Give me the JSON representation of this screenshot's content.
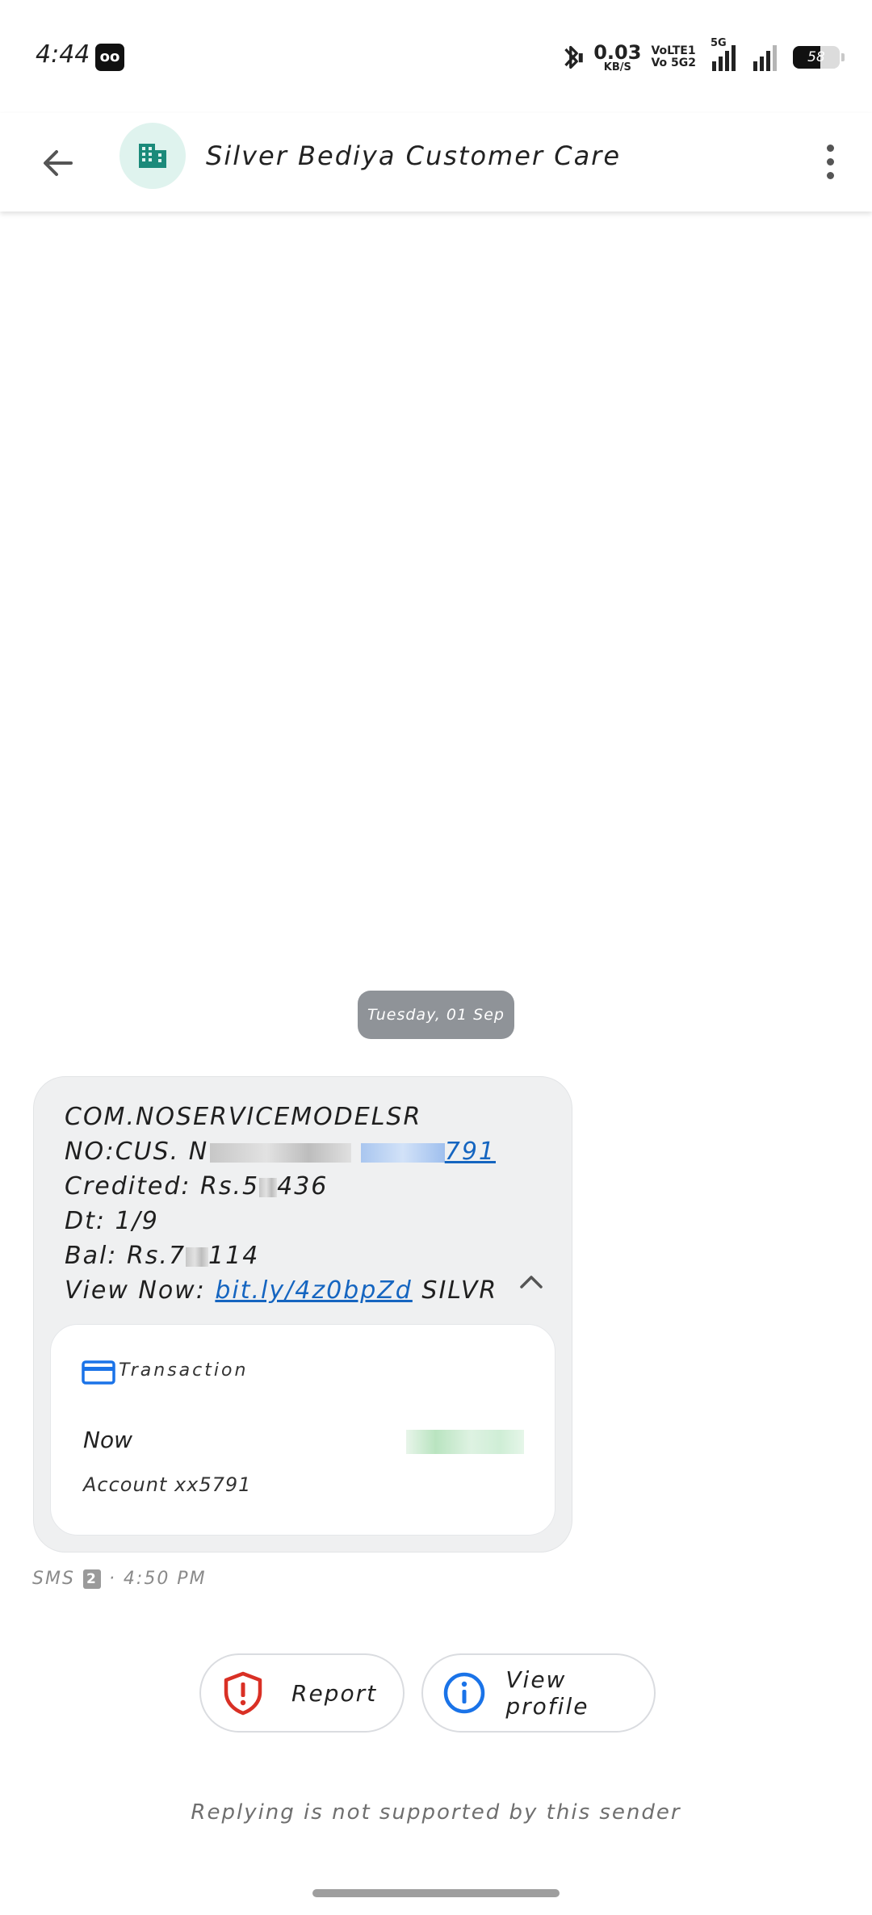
{
  "status_bar": {
    "time": "4:44",
    "app_icon": "oo",
    "net_speed_value": "0.03",
    "net_speed_unit": "KB/S",
    "volte_line1": "VoLTE1",
    "volte_line2": "Vo 5G2",
    "sim1_network": "5G",
    "battery_level": "58",
    "battery_fraction": 0.58,
    "icons": [
      "bluetooth-icon",
      "signal-icon",
      "battery-icon"
    ]
  },
  "app_bar": {
    "contact_name": "Silver Bediya Customer Care",
    "icons": [
      "back-arrow-icon",
      "business-icon",
      "more-vert-icon"
    ]
  },
  "date_chip": "Tuesday, 01 Sep",
  "message": {
    "line1": "COM.NOSERVICEMODELSR",
    "line2_prefix": "NO:CUS. N",
    "line2_link_tail": "791",
    "line3_prefix": "Credited: Rs.5",
    "line3_suffix": "436",
    "line4": "Dt: 1/9",
    "line5_prefix": "Bal: Rs.7",
    "line5_suffix": "114",
    "line6_prefix": "View Now: ",
    "line6_link": "bit.ly/4z0bpZd",
    "line6_suffix": " SILVR"
  },
  "transaction_card": {
    "title": "Transaction",
    "when": "Now",
    "account": "Account xx5791",
    "icon": "credit-card-icon"
  },
  "meta": {
    "type": "SMS",
    "sim": "2",
    "time": "· 4:50 PM"
  },
  "actions": {
    "report_label": "Report",
    "view_profile_label": "View profile"
  },
  "footer_note": "Replying is not supported by this sender",
  "colors": {
    "accent_blue": "#1a73e8",
    "report_red": "#d93025",
    "bubble_bg": "#eff0f1",
    "date_chip_bg": "#8f9398",
    "avatar_bg": "#dff3ee",
    "avatar_icon": "#1b8a7a"
  }
}
